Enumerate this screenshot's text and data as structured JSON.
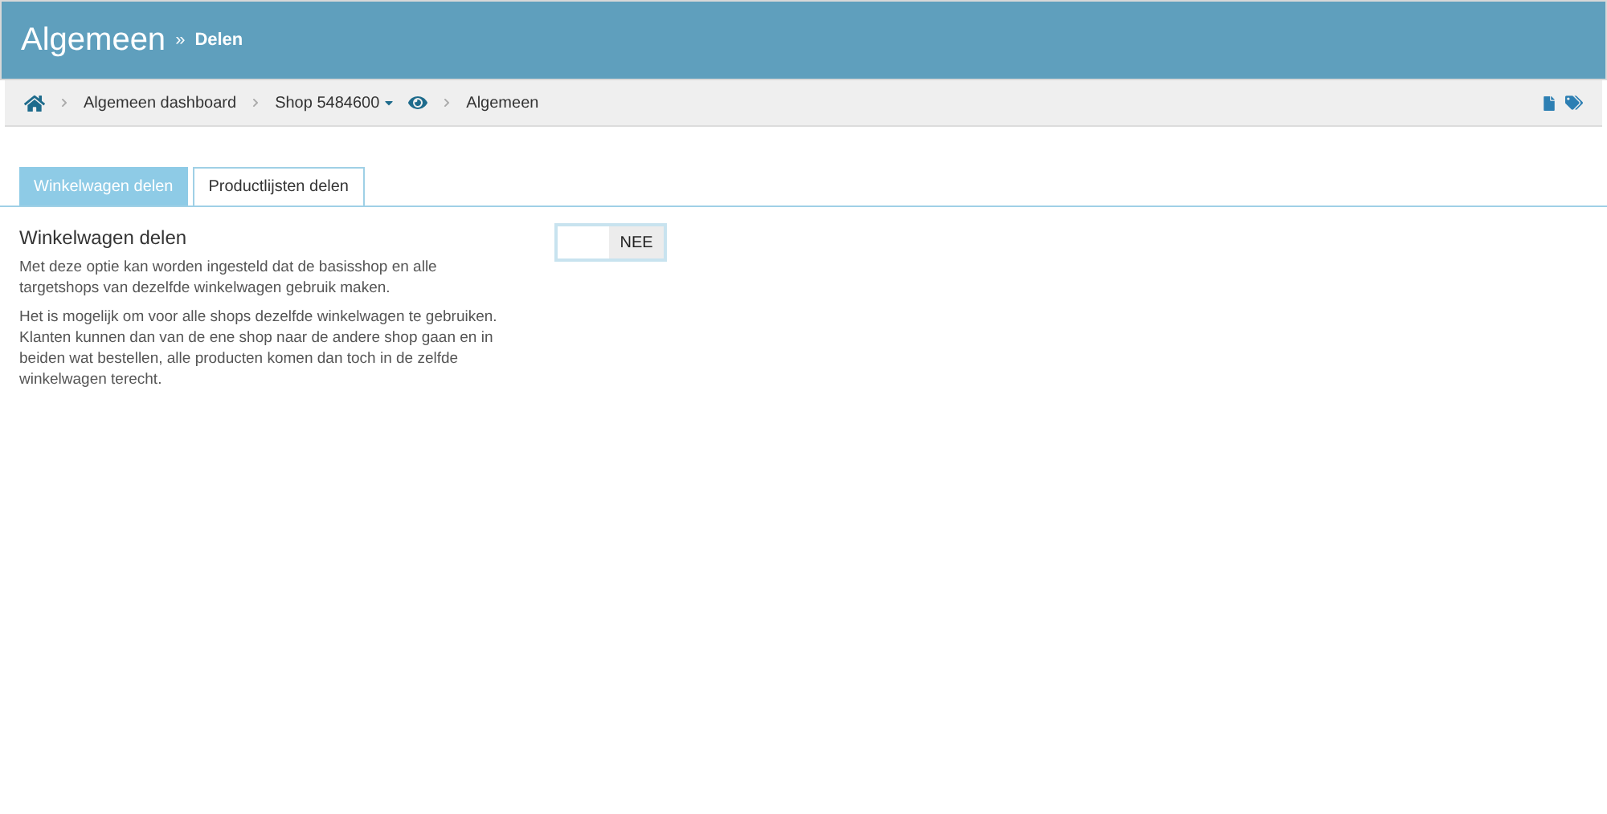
{
  "header": {
    "title": "Algemeen",
    "separator": "»",
    "subtitle": "Delen"
  },
  "breadcrumb": [
    {
      "label": "Algemeen dashboard",
      "dropdown": false,
      "preview": false
    },
    {
      "label": "Shop 5484600",
      "dropdown": true,
      "preview": true
    },
    {
      "label": "Algemeen",
      "dropdown": false,
      "preview": false
    }
  ],
  "tabs": [
    {
      "label": "Winkelwagen delen",
      "selected": true
    },
    {
      "label": "Productlijsten delen",
      "selected": false
    }
  ],
  "setting": {
    "title": "Winkelwagen delen",
    "paragraphs": [
      "Met deze optie kan worden ingesteld dat de basisshop en alle targetshops van dezelfde winkelwagen gebruik maken.",
      "Het is mogelijk om voor alle shops dezelfde winkelwagen te gebruiken. Klanten kunnen dan van de ene shop naar de andere shop gaan en in beiden wat bestellen, alle producten komen dan toch in de zelfde winkelwagen terecht."
    ],
    "toggle": {
      "label": "NEE",
      "on": false
    }
  }
}
